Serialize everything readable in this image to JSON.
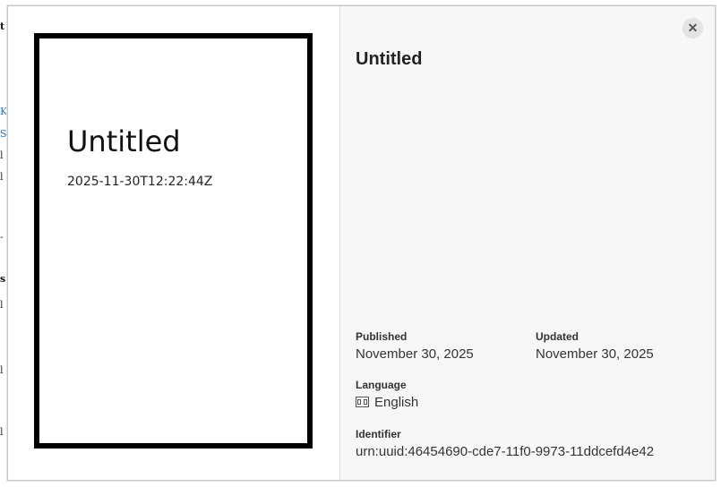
{
  "background_fragments": [
    "t",
    "K",
    "S",
    "l",
    "l",
    "-",
    "s",
    "l",
    "l",
    "l"
  ],
  "cover": {
    "title": "Untitled",
    "date": "2025-11-30T12:22:44Z"
  },
  "details": {
    "title": "Untitled",
    "published_label": "Published",
    "published_value": "November 30, 2025",
    "updated_label": "Updated",
    "updated_value": "November 30, 2025",
    "language_label": "Language",
    "language_value": "English",
    "identifier_label": "Identifier",
    "identifier_value": "urn:uuid:46454690-cde7-11f0-9973-11ddcefd4e42"
  },
  "close_label": "✕",
  "icons": {
    "close": "close-icon",
    "language": "language-icon"
  }
}
